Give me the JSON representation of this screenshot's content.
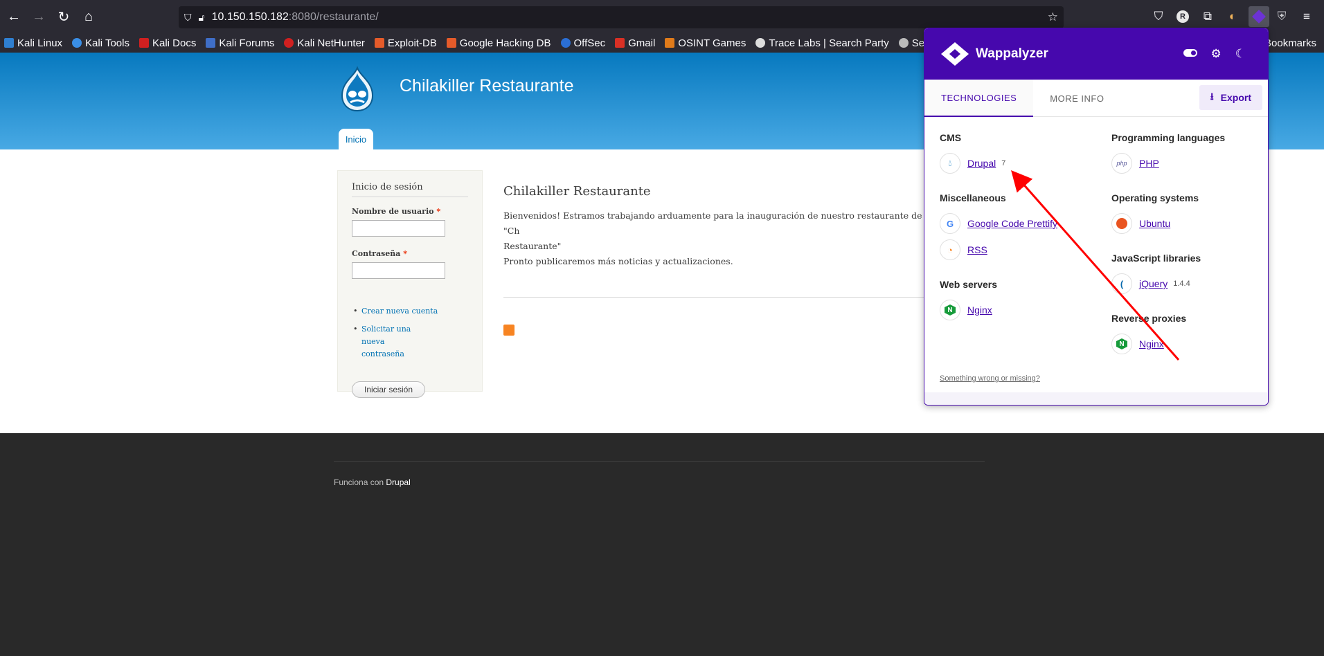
{
  "browser": {
    "url_host": "10.150.150.182",
    "url_rest": ":8080/restaurante/",
    "bookmarks": [
      "Kali Linux",
      "Kali Tools",
      "Kali Docs",
      "Kali Forums",
      "Kali NetHunter",
      "Exploit-DB",
      "Google Hacking DB",
      "OffSec",
      "Gmail",
      "OSINT Games",
      "Trace Labs | Search Party",
      "Security Bl",
      "Bookmarks"
    ]
  },
  "site": {
    "name": "Chilakiller Restaurante",
    "tab_inicio": "Inicio",
    "login": {
      "title": "Inicio de sesión",
      "username_label": "Nombre de usuario",
      "password_label": "Contraseña",
      "required_mark": "*",
      "links": [
        "Crear nueva cuenta",
        "Solicitar una nueva contraseña"
      ],
      "submit": "Iniciar sesión"
    },
    "main": {
      "title": "Chilakiller Restaurante",
      "para1": "Bienvenidos! Estramos trabajando arduamente para la inauguración de nuestro restaurante de chilaquiles \"Ch",
      "para1b": "Restaurante\"",
      "para2": "Pronto publicaremos más noticias y actualizaciones."
    },
    "footer": {
      "prefix": "Funciona con",
      "link": "Drupal"
    }
  },
  "wappalyzer": {
    "title": "Wappalyzer",
    "tabs": [
      "TECHNOLOGIES",
      "MORE INFO"
    ],
    "export": "Export",
    "categories_left": [
      {
        "title": "CMS",
        "techs": [
          {
            "name": "Drupal",
            "version": "7",
            "icon": "drupal-icon"
          }
        ]
      },
      {
        "title": "Miscellaneous",
        "techs": [
          {
            "name": "Google Code Prettify",
            "version": "",
            "icon": "google-icon"
          },
          {
            "name": "RSS",
            "version": "",
            "icon": "rss-icon"
          }
        ]
      },
      {
        "title": "Web servers",
        "techs": [
          {
            "name": "Nginx",
            "version": "",
            "icon": "nginx-icon"
          }
        ]
      }
    ],
    "categories_right": [
      {
        "title": "Programming languages",
        "techs": [
          {
            "name": "PHP",
            "version": "",
            "icon": "php-icon"
          }
        ]
      },
      {
        "title": "Operating systems",
        "techs": [
          {
            "name": "Ubuntu",
            "version": "",
            "icon": "ubuntu-icon"
          }
        ]
      },
      {
        "title": "JavaScript libraries",
        "techs": [
          {
            "name": "jQuery",
            "version": "1.4.4",
            "icon": "jquery-icon"
          }
        ]
      },
      {
        "title": "Reverse proxies",
        "techs": [
          {
            "name": "Nginx",
            "version": "",
            "icon": "nginx-icon"
          }
        ]
      }
    ],
    "report_link": "Something wrong or missing?"
  },
  "colors": {
    "accent": "#4608ad",
    "annotation_arrow": "#ff0000"
  }
}
